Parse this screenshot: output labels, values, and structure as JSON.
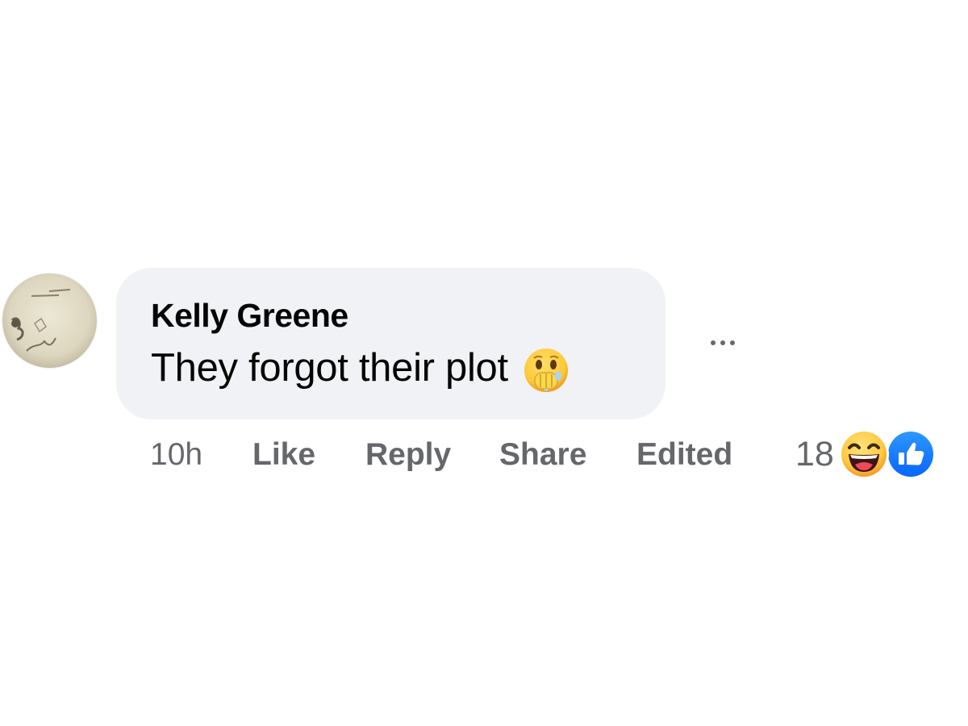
{
  "comment": {
    "author": "Kelly Greene",
    "text": "They forgot their plot",
    "inline_emoji": "face-with-hand-over-mouth-emoji",
    "avatar_icon": "profile-avatar"
  },
  "actions": {
    "time": "10h",
    "like_label": "Like",
    "reply_label": "Reply",
    "share_label": "Share",
    "edited_label": "Edited"
  },
  "reactions": {
    "count": "18",
    "icons": [
      "haha-reaction-icon",
      "like-reaction-icon"
    ]
  },
  "menu": {
    "more_icon": "more-options-icon"
  },
  "colors": {
    "bubble_bg": "#f0f2f5",
    "text": "#050505",
    "secondary_text": "#65676b",
    "like_blue": "#1877f2",
    "haha_yellow": "#f7b928"
  }
}
